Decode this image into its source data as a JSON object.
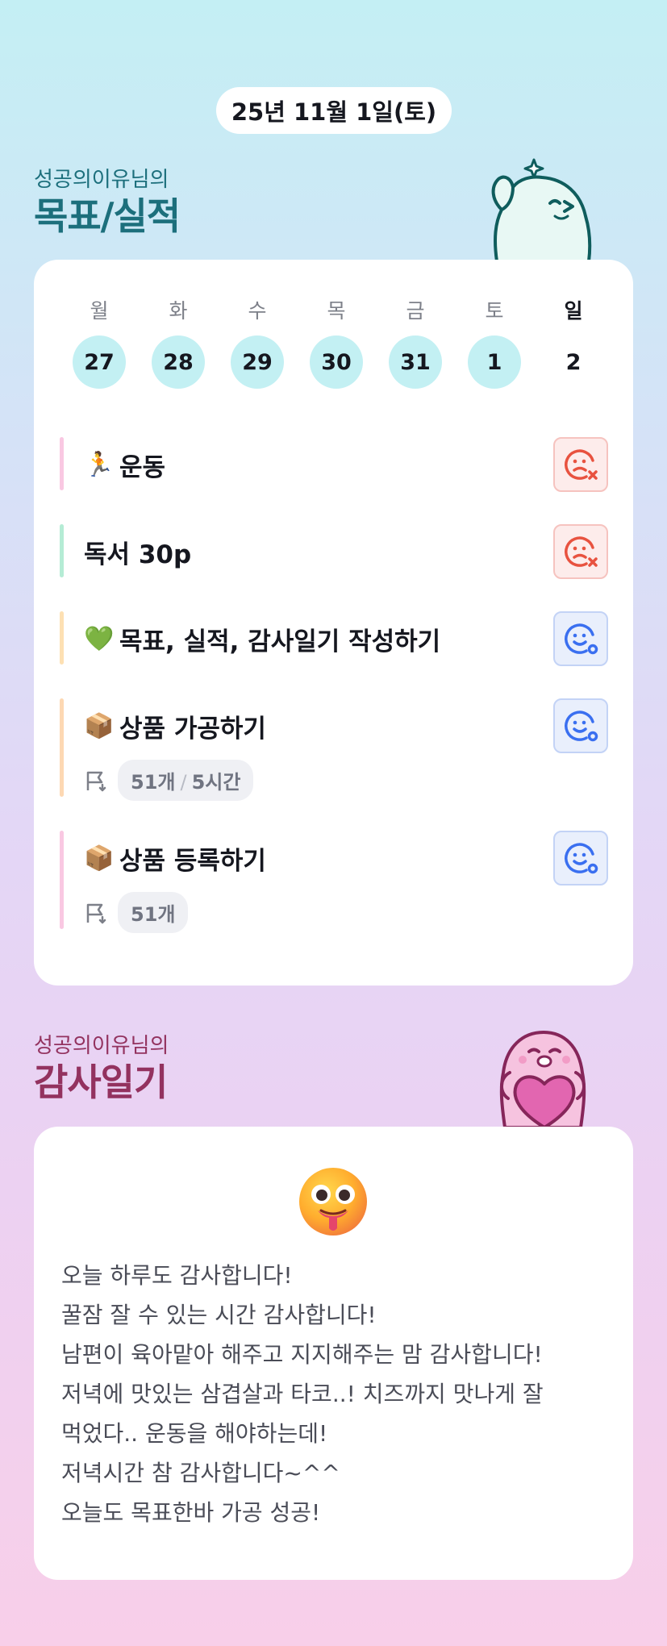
{
  "date_label": "25년 11월 1일(토)",
  "goals_section": {
    "subtitle": "성공의이유님의",
    "title": "목표/실적"
  },
  "week": [
    {
      "day": "월",
      "date": "27",
      "done": true
    },
    {
      "day": "화",
      "date": "28",
      "done": true
    },
    {
      "day": "수",
      "date": "29",
      "done": true
    },
    {
      "day": "목",
      "date": "30",
      "done": true
    },
    {
      "day": "금",
      "date": "31",
      "done": true
    },
    {
      "day": "토",
      "date": "1",
      "done": true
    },
    {
      "day": "일",
      "date": "2",
      "done": false
    }
  ],
  "goals": [
    {
      "emoji": "🏃",
      "label": "운동",
      "status": "fail",
      "bar_color": "#f9c8e2"
    },
    {
      "emoji": "",
      "label": "독서 30p",
      "status": "fail",
      "bar_color": "#b5ecd5"
    },
    {
      "emoji": "💚",
      "label": "목표, 실적, 감사일기 작성하기",
      "status": "success",
      "bar_color": "#fde0b3"
    },
    {
      "emoji": "📦",
      "label": "상품 가공하기",
      "status": "success",
      "bar_color": "#fdd8b3",
      "metric_a": "51개",
      "metric_sep": "/",
      "metric_b": "5시간"
    },
    {
      "emoji": "📦",
      "label": "상품 등록하기",
      "status": "success",
      "bar_color": "#f9c8e2",
      "metric_a": "51개"
    }
  ],
  "gratitude_section": {
    "subtitle": "성공의이유님의",
    "title": "감사일기"
  },
  "diary": {
    "mood_icon": "tongue-out-emoji",
    "lines": [
      "오늘 하루도 감사합니다!",
      "꿀잠 잘 수 있는 시간 감사합니다!",
      "남편이 육아맡아 해주고 지지해주는 맘 감사합니다!",
      "저녁에 맛있는 삼겹살과 타코..! 치즈까지 맛나게 잘",
      "먹었다.. 운동을 해야하는데!",
      "저녁시간 참 감사합니다~^^",
      "오늘도 목표한바 가공 성공!"
    ]
  },
  "colors": {
    "goals_title": "#1c6f7c",
    "gratitude_title": "#93325f",
    "fail": "#e8523f",
    "success": "#3a6ff0"
  }
}
